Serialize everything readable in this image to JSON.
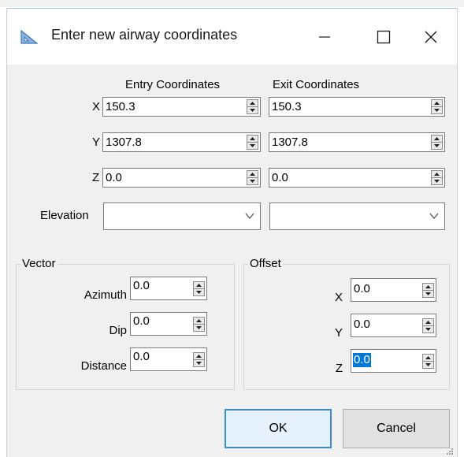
{
  "window": {
    "title": "Enter new airway coordinates"
  },
  "headers": {
    "entry": "Entry Coordinates",
    "exit": "Exit Coordinates"
  },
  "coords": {
    "x_label": "X",
    "y_label": "Y",
    "z_label": "Z",
    "entry_x": "150.3",
    "entry_y": "1307.8",
    "entry_z": "0.0",
    "exit_x": "150.3",
    "exit_y": "1307.8",
    "exit_z": "0.0"
  },
  "elevation": {
    "label": "Elevation",
    "entry_value": "",
    "exit_value": ""
  },
  "vector": {
    "legend": "Vector",
    "azimuth_label": "Azimuth",
    "azimuth": "0.0",
    "dip_label": "Dip",
    "dip": "0.0",
    "distance_label": "Distance",
    "distance": "0.0"
  },
  "offset": {
    "legend": "Offset",
    "x_label": "X",
    "x": "0.0",
    "y_label": "Y",
    "y": "0.0",
    "z_label": "Z",
    "z": "0.0"
  },
  "buttons": {
    "ok": "OK",
    "cancel": "Cancel"
  },
  "icons": {
    "app": "set-square-icon",
    "minimize": "minimize-icon",
    "maximize": "maximize-icon",
    "close": "close-icon",
    "spin_up": "spin-up-icon",
    "spin_down": "spin-down-icon",
    "dropdown": "chevron-down-icon"
  },
  "colors": {
    "accent": "#0078d7",
    "dialog_bg": "#f0f0f0",
    "default_button_border": "#3c8ad6"
  }
}
